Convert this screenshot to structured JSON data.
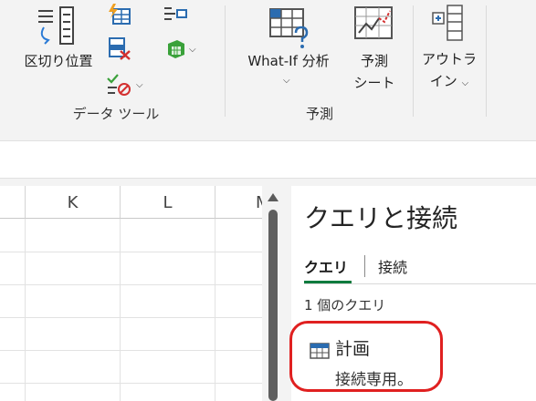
{
  "ribbon": {
    "data_tools": {
      "group_label": "データ ツール",
      "text_to_columns_label": "区切り位置"
    },
    "forecast": {
      "group_label": "予測",
      "whatif_label": "What-If 分析",
      "forecast_sheet_line1": "予測",
      "forecast_sheet_line2": "シート"
    },
    "outline": {
      "label_line1": "アウトラ",
      "label_line2": "イン"
    }
  },
  "sheet": {
    "columns": [
      "K",
      "L",
      "M"
    ]
  },
  "queries_pane": {
    "title": "クエリと接続",
    "tabs": [
      "クエリ",
      "接続"
    ],
    "count_text": "1 個のクエリ",
    "items": [
      {
        "name": "計画",
        "description": "接続専用。"
      }
    ]
  },
  "colors": {
    "accent_green": "#0f7b3e",
    "highlight_red": "#e02020",
    "icon_blue": "#2b6cb0",
    "icon_green": "#3aa13a"
  }
}
